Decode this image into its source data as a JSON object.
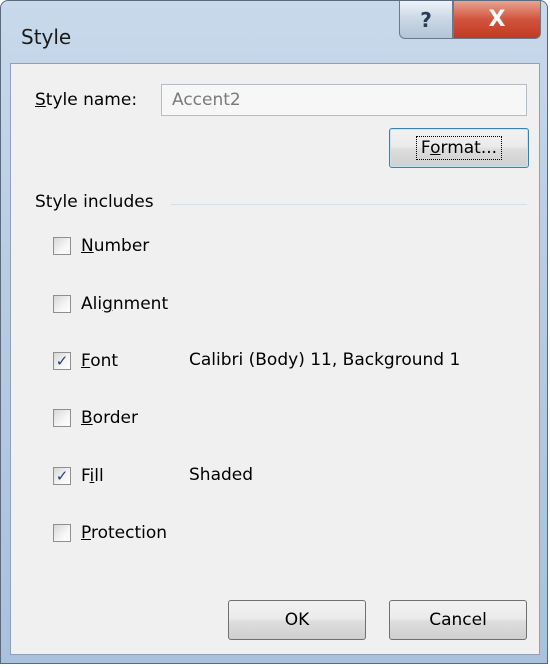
{
  "window": {
    "title": "Style",
    "help_glyph": "?",
    "close_glyph": "X"
  },
  "style_name": {
    "label_accel": "S",
    "label_rest": "tyle name:",
    "value": "Accent2"
  },
  "format_button": {
    "prefix": "F",
    "accel": "o",
    "suffix": "rmat..."
  },
  "style_includes": {
    "label": "Style includes",
    "items": [
      {
        "accel": "N",
        "rest": "umber",
        "checked": false,
        "description": ""
      },
      {
        "pre": "Ali",
        "accel": "g",
        "rest": "nment",
        "checked": false,
        "description": ""
      },
      {
        "accel": "F",
        "rest": "ont",
        "checked": true,
        "description": "Calibri (Body) 11, Background 1"
      },
      {
        "accel": "B",
        "rest": "order",
        "checked": false,
        "description": ""
      },
      {
        "pre": "F",
        "accel": "i",
        "rest": "ll",
        "checked": true,
        "description": "Shaded"
      },
      {
        "accel": "P",
        "rest": "rotection",
        "checked": false,
        "description": ""
      }
    ],
    "check_glyph": "✓"
  },
  "buttons": {
    "ok": "OK",
    "cancel": "Cancel"
  }
}
